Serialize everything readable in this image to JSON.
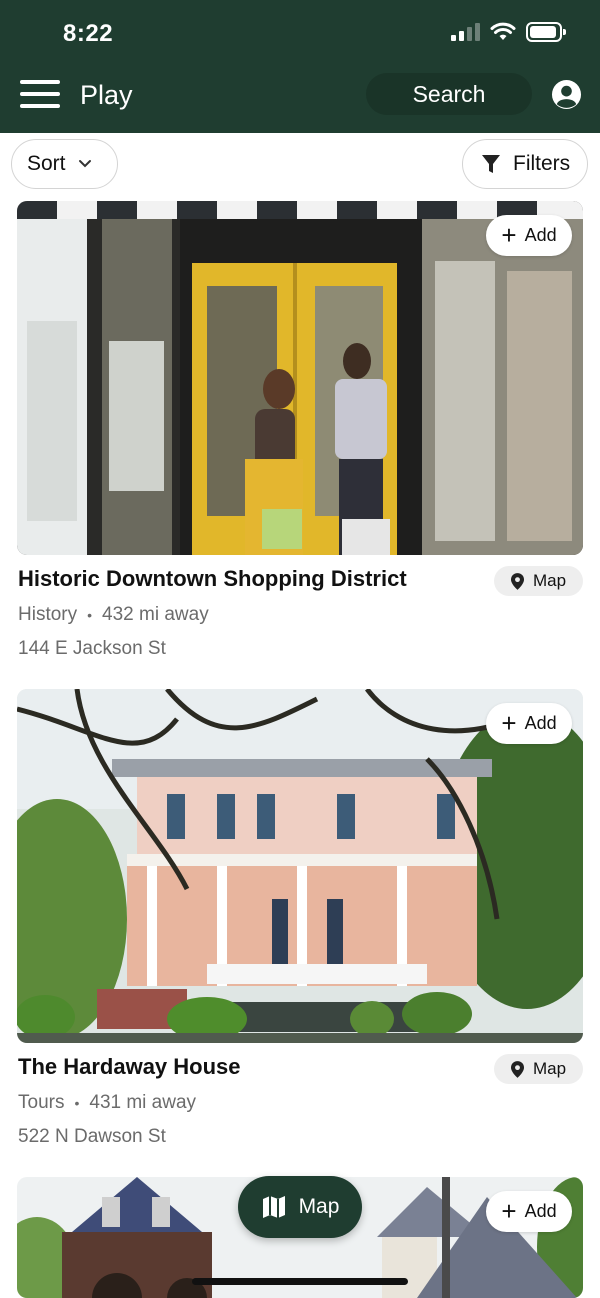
{
  "status_bar": {
    "time": "8:22"
  },
  "header": {
    "title": "Play",
    "search_label": "Search"
  },
  "controls": {
    "sort_label": "Sort",
    "filters_label": "Filters"
  },
  "cards": [
    {
      "title": "Historic Downtown Shopping District",
      "category": "History",
      "distance": "432 mi away",
      "address": "144 E Jackson St",
      "add_label": "Add",
      "map_label": "Map"
    },
    {
      "title": "The Hardaway House",
      "category": "Tours",
      "distance": "431 mi away",
      "address": "522 N Dawson St",
      "add_label": "Add",
      "map_label": "Map"
    },
    {
      "add_label": "Add"
    }
  ],
  "fab": {
    "map_label": "Map"
  },
  "colors": {
    "brand_green": "#1f3d30",
    "search_pill": "#1a3428",
    "chip_bg": "#eeeeee",
    "meta_text": "#6b6b6b"
  }
}
